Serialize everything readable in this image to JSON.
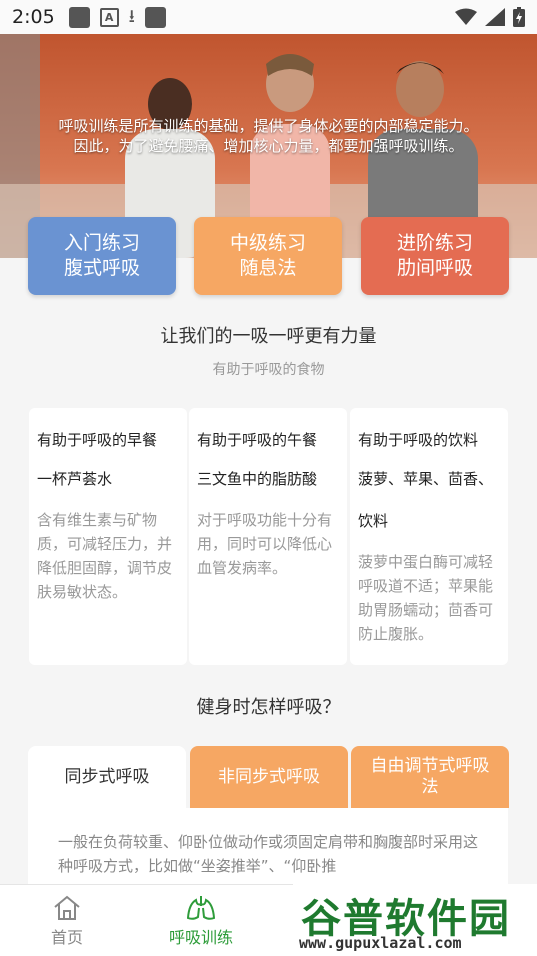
{
  "status_bar": {
    "time": "2:05"
  },
  "hero": {
    "line1": "呼吸训练是所有训练的基础，提供了身体必要的内部稳定能力。",
    "line2": "因此，为了避免腰痛、增加核心力量，都要加强呼吸训练。"
  },
  "levels": [
    {
      "title": "入门练习",
      "subtitle": "腹式呼吸",
      "color": "#6a93d2"
    },
    {
      "title": "中级练习",
      "subtitle": "随息法",
      "color": "#f6a763"
    },
    {
      "title": "进阶练习",
      "subtitle": "肋间呼吸",
      "color": "#e46c52"
    }
  ],
  "foods_section": {
    "title": "让我们的一吸一呼更有力量",
    "subtitle": "有助于呼吸的食物"
  },
  "food_cards": [
    {
      "title": "有助于呼吸的早餐",
      "item": "一杯芦荟水",
      "desc": "含有维生素与矿物质，可减轻压力，并降低胆固醇，调节皮肤易敏状态。"
    },
    {
      "title": "有助于呼吸的午餐",
      "item": "三文鱼中的脂肪酸",
      "desc": "对于呼吸功能十分有用，同时可以降低心血管发病率。"
    },
    {
      "title": "有助于呼吸的饮料",
      "item": "菠萝、苹果、茴香、饮料",
      "desc": "菠萝中蛋白酶可减轻呼吸道不适；苹果能助胃肠蠕动；茴香可防止腹胀。"
    }
  ],
  "breathing_section": {
    "title": "健身时怎样呼吸？"
  },
  "breathing_tabs": [
    {
      "label": "同步式呼吸"
    },
    {
      "label": "非同步式呼吸"
    },
    {
      "label": "自由调节式呼吸法"
    }
  ],
  "breathing_content": "一般在负荷较重、仰卧位做动作或须固定肩带和胸腹部时采用这种呼吸方式，比如做“坐姿推举”、“仰卧推",
  "bottom_nav": [
    {
      "label": "首页",
      "icon": "home-icon"
    },
    {
      "label": "呼吸训练",
      "icon": "lungs-icon"
    }
  ],
  "watermark": {
    "title": "谷普软件园",
    "url": "www.gupuxlazal.com"
  },
  "colors": {
    "accent_green": "#2e9c3a",
    "orange": "#f6a763"
  }
}
